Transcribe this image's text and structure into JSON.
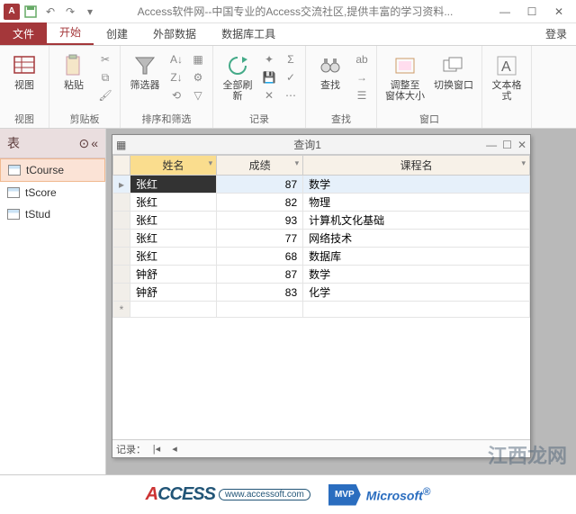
{
  "titlebar": {
    "title": "Access软件网--中国专业的Access交流社区,提供丰富的学习资料..."
  },
  "ribbon": {
    "tabs": {
      "file": "文件",
      "home": "开始",
      "create": "创建",
      "external": "外部数据",
      "dbtools": "数据库工具"
    },
    "login": "登录",
    "groups": {
      "view": {
        "label": "视图",
        "view_btn": "视图"
      },
      "clipboard": {
        "label": "剪贴板",
        "paste_btn": "粘贴"
      },
      "sortfilter": {
        "label": "排序和筛选",
        "filter_btn": "筛选器"
      },
      "records": {
        "label": "记录",
        "refresh_btn": "全部刷新"
      },
      "find": {
        "label": "查找",
        "find_btn": "查找"
      },
      "window": {
        "label": "窗口",
        "size_btn": "调整至\n窗体大小",
        "switch_btn": "切换窗口"
      },
      "textfmt": {
        "label": "文本格式"
      }
    }
  },
  "navpane": {
    "header": "表",
    "items": [
      {
        "name": "tCourse",
        "selected": true
      },
      {
        "name": "tScore",
        "selected": false
      },
      {
        "name": "tStud",
        "selected": false
      }
    ]
  },
  "query": {
    "title": "查询1",
    "columns": {
      "name": "姓名",
      "score": "成绩",
      "course": "课程名"
    },
    "rows": [
      {
        "name": "张红",
        "score": 87,
        "course": "数学"
      },
      {
        "name": "张红",
        "score": 82,
        "course": "物理"
      },
      {
        "name": "张红",
        "score": 93,
        "course": "计算机文化基础"
      },
      {
        "name": "张红",
        "score": 77,
        "course": "网络技术"
      },
      {
        "name": "张红",
        "score": 68,
        "course": "数据库"
      },
      {
        "name": "钟舒",
        "score": 87,
        "course": "数学"
      },
      {
        "name": "钟舒",
        "score": 83,
        "course": "化学"
      }
    ],
    "nav": {
      "label": "记录："
    }
  },
  "footer": {
    "access_url": "www.accessoft.com",
    "mvp": "MVP",
    "ms": "Microsoft",
    "watermark": "江西龙网"
  }
}
